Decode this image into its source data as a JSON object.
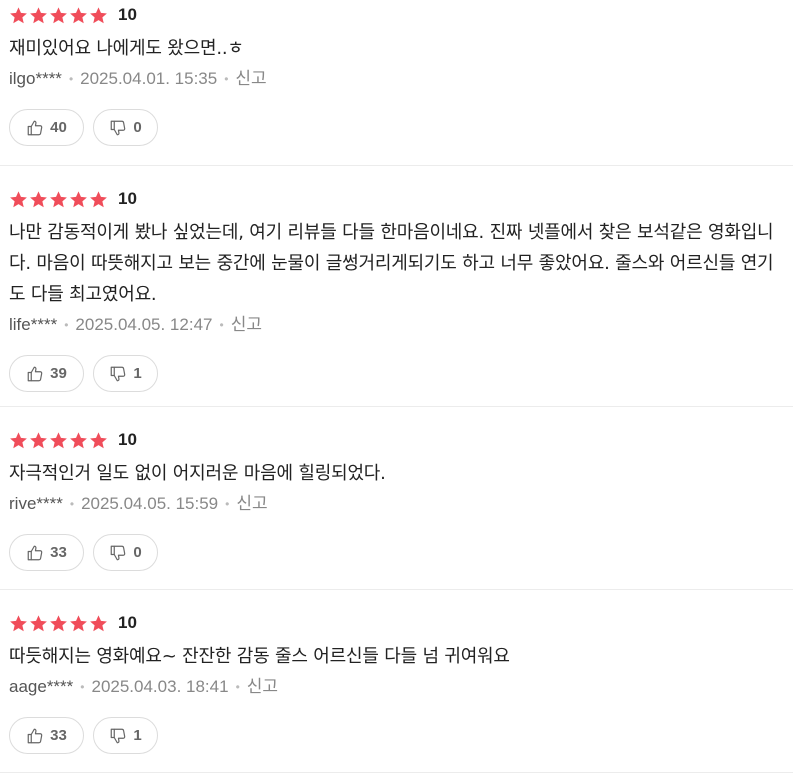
{
  "reviews": [
    {
      "rating": 5,
      "score": "10",
      "text": "재미있어요 나에게도 왔으면..ㅎ",
      "user": "ilgo****",
      "date": "2025.04.01. 15:35",
      "report": "신고",
      "likes": "40",
      "dislikes": "0"
    },
    {
      "rating": 5,
      "score": "10",
      "text": "나만 감동적이게 봤나 싶었는데, 여기 리뷰들 다들 한마음이네요. 진짜 넷플에서 찾은 보석같은 영화입니다. 마음이 따뜻해지고 보는 중간에 눈물이 글썽거리게되기도 하고 너무 좋았어요. 줄스와 어르신들 연기도 다들 최고였어요.",
      "user": "life****",
      "date": "2025.04.05. 12:47",
      "report": "신고",
      "likes": "39",
      "dislikes": "1"
    },
    {
      "rating": 5,
      "score": "10",
      "text": "자극적인거 일도 없이 어지러운 마음에 힐링되었다.",
      "user": "rive****",
      "date": "2025.04.05. 15:59",
      "report": "신고",
      "likes": "33",
      "dislikes": "0"
    },
    {
      "rating": 5,
      "score": "10",
      "text": "따듯해지는 영화예요~ 잔잔한 감동 줄스 어르신들 다들 넘 귀여워요",
      "user": "aage****",
      "date": "2025.04.03. 18:41",
      "report": "신고",
      "likes": "33",
      "dislikes": "1"
    }
  ],
  "colors": {
    "star": "#f04d5a",
    "text": "#222222",
    "meta": "#888888",
    "border": "#dcdcdc"
  },
  "icons": {
    "star": "star-icon",
    "like": "thumbs-up-icon",
    "dislike": "thumbs-down-icon"
  }
}
